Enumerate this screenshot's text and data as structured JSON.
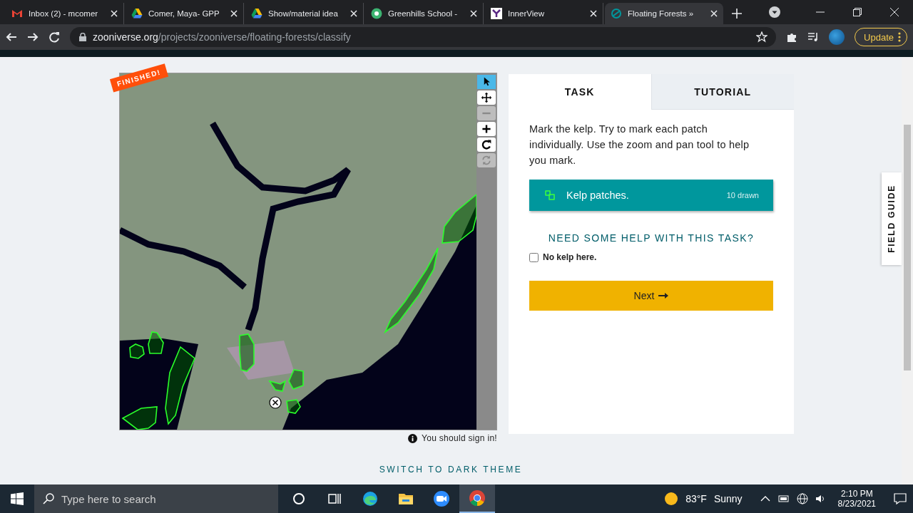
{
  "browser": {
    "tabs": [
      {
        "title": "Inbox (2) - mcomer",
        "kind": "gmail",
        "selected": false
      },
      {
        "title": "Comer, Maya- GPP",
        "kind": "drive",
        "selected": false
      },
      {
        "title": "Show/material idea",
        "kind": "drive",
        "selected": false
      },
      {
        "title": "Greenhills School -",
        "kind": "school",
        "selected": false
      },
      {
        "title": "InnerView",
        "kind": "innerview",
        "selected": false
      },
      {
        "title": "Floating Forests »",
        "kind": "zooniverse",
        "selected": true
      }
    ],
    "address": {
      "domain": "zooniverse.org",
      "path": "/projects/zooniverse/floating-forests/classify"
    },
    "update_button": "Update"
  },
  "subject": {
    "badge": "FINISHED!",
    "tools": [
      {
        "kind": "pointer",
        "selected": true,
        "disabled": false
      },
      {
        "kind": "move",
        "selected": false,
        "disabled": false
      },
      {
        "kind": "zoom-out",
        "selected": false,
        "disabled": true
      },
      {
        "kind": "zoom-in",
        "selected": false,
        "disabled": false
      },
      {
        "kind": "rotate",
        "selected": false,
        "disabled": false
      },
      {
        "kind": "reset",
        "selected": false,
        "disabled": true
      }
    ],
    "notice": "You should sign in!"
  },
  "task_panel": {
    "tabs": [
      {
        "label": "TASK",
        "selected": true
      },
      {
        "label": "TUTORIAL",
        "selected": false
      }
    ],
    "instruction": "Mark the kelp. Try to mark each patch individually. Use the zoom and pan tool to help you mark.",
    "tool": {
      "label": "Kelp patches.",
      "count": "10 drawn",
      "selected": true
    },
    "help": "NEED SOME HELP WITH THIS TASK?",
    "checkbox": {
      "label": "No kelp here.",
      "checked": false
    },
    "next_button": "Next"
  },
  "field_guide": "FIELD GUIDE",
  "theme_link": "SWITCH TO DARK THEME",
  "taskbar": {
    "search": {
      "placeholder": "Type here to search"
    },
    "apps": [
      {
        "kind": "cortana",
        "selected": false
      },
      {
        "kind": "task-view",
        "selected": false
      },
      {
        "kind": "edge",
        "selected": false
      },
      {
        "kind": "folder",
        "selected": false
      },
      {
        "kind": "zoom",
        "selected": false
      },
      {
        "kind": "chrome",
        "selected": true
      }
    ],
    "weather": {
      "temperature": "83°F",
      "condition": "Sunny"
    },
    "clock": {
      "time": "2:10 PM",
      "date": "8/23/2021"
    }
  }
}
